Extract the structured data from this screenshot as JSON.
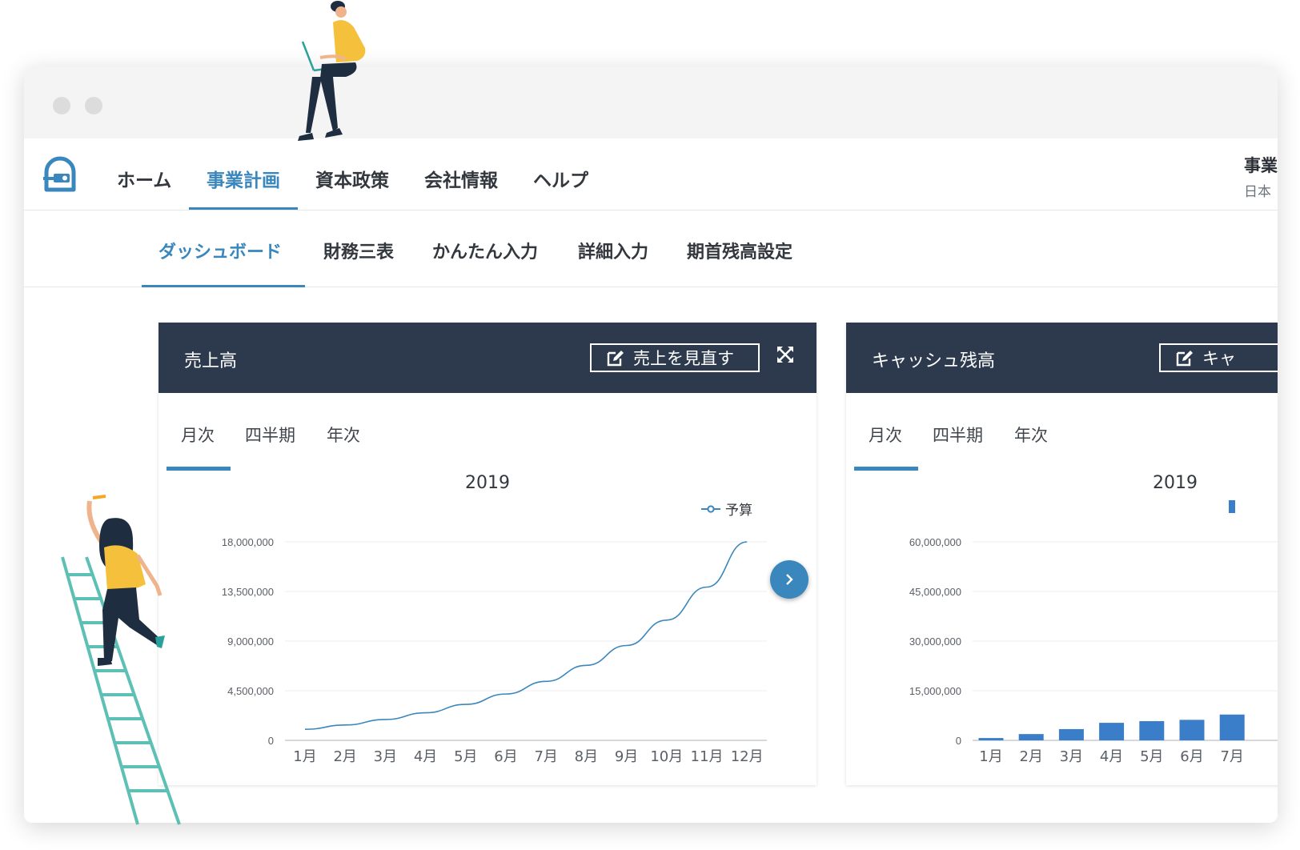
{
  "nav": {
    "items": [
      {
        "label": "ホーム"
      },
      {
        "label": "事業計画"
      },
      {
        "label": "資本政策"
      },
      {
        "label": "会社情報"
      },
      {
        "label": "ヘルプ"
      }
    ],
    "active_index": 1,
    "account_name": "事業",
    "account_sub": "日本"
  },
  "subnav": {
    "items": [
      {
        "label": "ダッシュボード"
      },
      {
        "label": "財務三表"
      },
      {
        "label": "かんたん入力"
      },
      {
        "label": "詳細入力"
      },
      {
        "label": "期首残高設定"
      }
    ],
    "active_index": 0
  },
  "cards": [
    {
      "title": "売上高",
      "edit_label": "売上を見直す",
      "tabs": [
        "月次",
        "四半期",
        "年次"
      ],
      "active_tab": 0,
      "year": "2019",
      "legend": "予算"
    },
    {
      "title": "キャッシュ残高",
      "edit_label": "キャ",
      "tabs": [
        "月次",
        "四半期",
        "年次"
      ],
      "active_tab": 0,
      "year": "2019"
    }
  ],
  "colors": {
    "accent": "#3a87bd",
    "header_dark": "#2d3a4e",
    "bar": "#3a7dc8"
  },
  "chart_data": [
    {
      "type": "line",
      "title": "2019",
      "categories": [
        "1月",
        "2月",
        "3月",
        "4月",
        "5月",
        "6月",
        "7月",
        "8月",
        "9月",
        "10月",
        "11月",
        "12月"
      ],
      "series": [
        {
          "name": "予算",
          "values": [
            1000000,
            1390000,
            1890000,
            2500000,
            3260000,
            4200000,
            5350000,
            6800000,
            8600000,
            10900000,
            13900000,
            18000000
          ]
        }
      ],
      "yticks": [
        "18,000,000",
        "13,500,000",
        "9,000,000",
        "4,500,000",
        "0"
      ],
      "ylim": [
        0,
        18000000
      ],
      "grid": true,
      "legend_position": "top-right"
    },
    {
      "type": "bar",
      "title": "2019",
      "categories": [
        "1月",
        "2月",
        "3月",
        "4月",
        "5月",
        "6月",
        "7月"
      ],
      "series": [
        {
          "values": [
            700000,
            1900000,
            3400000,
            5300000,
            5800000,
            6200000,
            7800000
          ]
        }
      ],
      "yticks": [
        "60,000,000",
        "45,000,000",
        "30,000,000",
        "15,000,000",
        "0"
      ],
      "ylim": [
        0,
        60000000
      ],
      "grid": true
    }
  ]
}
